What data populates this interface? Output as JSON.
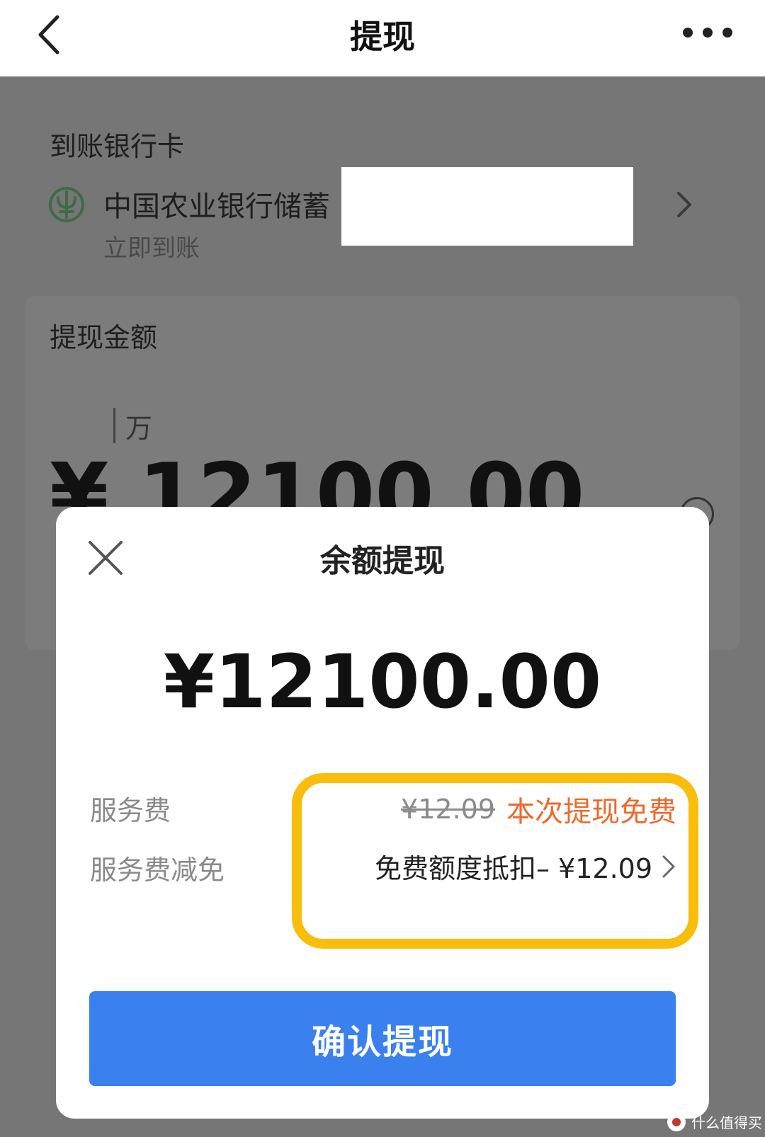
{
  "nav": {
    "title": "提现",
    "back_icon": "chevron-left-icon",
    "more_icon": "more-dots-icon"
  },
  "background": {
    "bank_section_label": "到账银行卡",
    "bank": {
      "name": "中国农业银行储蓄",
      "arrival": "立即到账",
      "logo_icon": "abc-bank-logo-icon",
      "logo_color": "#3f6b47"
    },
    "amount_section_label": "提现金额",
    "unit_hint": "万",
    "amount": "¥ 12100.00"
  },
  "modal": {
    "title": "余额提现",
    "amount": "¥12100.00",
    "service_fee_label": "服务费",
    "service_fee_original": "¥12.09",
    "service_fee_free": "本次提现免费",
    "fee_waiver_label": "服务费减免",
    "fee_waiver_value": "免费额度抵扣– ¥12.09",
    "confirm_label": "确认提现"
  },
  "colors": {
    "confirm_button": "#3a80ee",
    "free_text": "#ed6a2c",
    "highlight_border": "#f9bd0c",
    "overlay": "#767676"
  },
  "watermark": {
    "text": "什么值得买"
  }
}
